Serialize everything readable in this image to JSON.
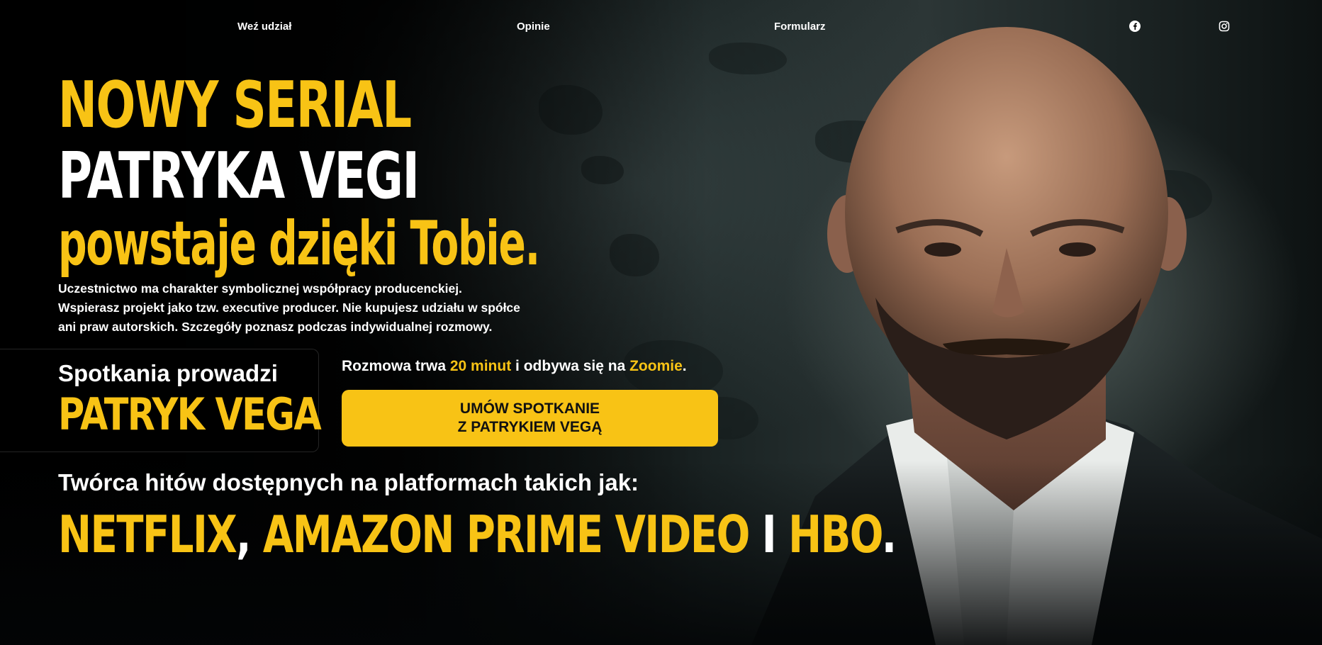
{
  "nav": {
    "items": [
      {
        "label": "Weź udział"
      },
      {
        "label": "Opinie"
      },
      {
        "label": "Formularz"
      }
    ],
    "social": [
      {
        "icon": "facebook-icon"
      },
      {
        "icon": "instagram-icon"
      }
    ]
  },
  "hero": {
    "line1": "NOWY SERIAL",
    "line2": "PATRYKA VEGI",
    "line3": "powstaje dzięki Tobie.",
    "description_lines": [
      "Uczestnictwo ma charakter symbolicznej współpracy producenckiej.",
      "Wspierasz projekt jako tzw. executive producer. Nie kupujesz udziału w spółce",
      "ani praw autorskich. Szczegóły poznasz podczas indywidualnej rozmowy."
    ]
  },
  "host": {
    "label": "Spotkania prowadzi",
    "name": "PATRYK VEGA"
  },
  "meeting": {
    "prefix": "Rozmowa trwa ",
    "duration": "20 minut",
    "middle": " i odbywa się na ",
    "platform": "Zoomie",
    "suffix": "."
  },
  "cta": {
    "line1": "UMÓW SPOTKANIE",
    "line2": "Z PATRYKIEM VEGĄ"
  },
  "creator": {
    "text": "Twórca hitów dostępnych na platformach takich jak:",
    "p1": "NETFLIX",
    "sep1": ", ",
    "p2": "AMAZON PRIME VIDEO",
    "sep2": " I ",
    "p3": "HBO",
    "end": "."
  },
  "colors": {
    "accent": "#f8c315",
    "background": "#000000",
    "text": "#ffffff"
  }
}
